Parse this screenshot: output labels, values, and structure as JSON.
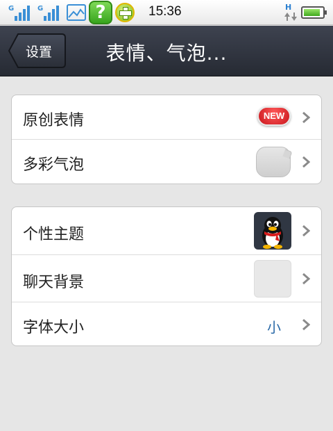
{
  "status_bar": {
    "sim1": "G",
    "sim2": "G",
    "help_glyph": "?",
    "time": "15:36",
    "network": "H",
    "icons": [
      "signal-sim1-icon",
      "signal-sim2-icon",
      "picture-notification-icon",
      "help-app-icon",
      "plus-app-icon",
      "hsdpa-icon",
      "battery-icon"
    ],
    "battery_level": 0.9
  },
  "title_bar": {
    "back_label": "设置",
    "title": "表情、气泡..."
  },
  "groups": [
    {
      "rows": [
        {
          "label": "原创表情",
          "badge": "NEW"
        },
        {
          "label": "多彩气泡",
          "preview": "gray-bubble"
        }
      ]
    },
    {
      "rows": [
        {
          "label": "个性主题",
          "preview": "qq-penguin-thumbnail"
        },
        {
          "label": "聊天背景",
          "preview": "blank-background-thumbnail"
        },
        {
          "label": "字体大小",
          "value": "小"
        }
      ]
    }
  ],
  "colors": {
    "titlebar": "#2e323c",
    "page_background": "#e6e6e6",
    "badge": "#d3191f",
    "value_text": "#2a6aa8",
    "chevron": "#8a8a8a"
  }
}
